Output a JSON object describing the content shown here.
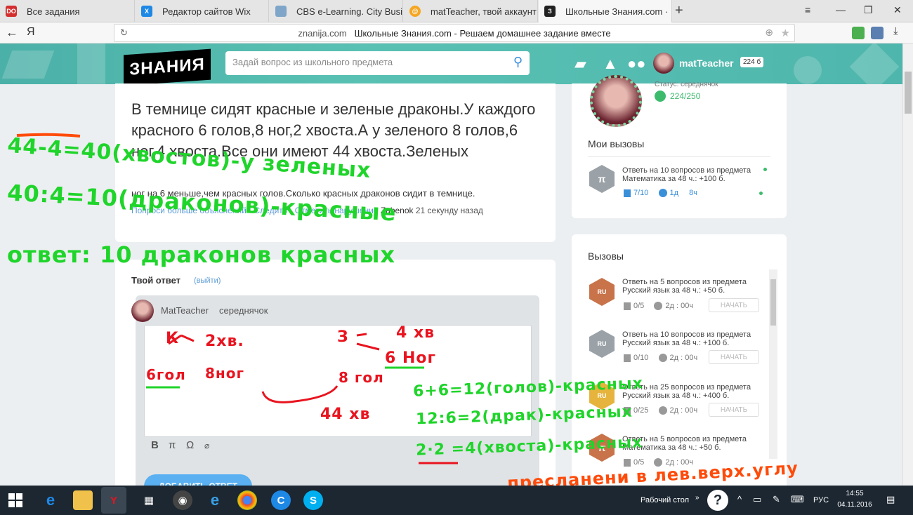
{
  "browser": {
    "tabs": [
      {
        "title": "Все задания",
        "icon": "dnevnik-icon",
        "color": "#d32f2f",
        "fav_text": "DO"
      },
      {
        "title": "Редактор сайтов Wix",
        "icon": "wix-icon",
        "color": "#1e88e5",
        "fav_text": "X"
      },
      {
        "title": "CBS e-Learning. City Busines",
        "icon": "cbs-icon",
        "color": "#7fa6c9",
        "fav_text": ""
      },
      {
        "title": "matTeacher, твой аккаунт го",
        "icon": "mail-icon",
        "color": "#f5a623",
        "fav_text": "@"
      },
      {
        "title": "Школьные Знания.com ·",
        "icon": "znanija-icon",
        "color": "#222222",
        "fav_text": "З"
      }
    ],
    "address_domain": "znanija.com",
    "address_title": "Школьные Знания.com - Решаем домашнее задание вместе",
    "yandex_label": "Я"
  },
  "header": {
    "logo_text": "ЗНАНИЯ",
    "search_placeholder": "Задай вопрос из школьного предмета",
    "username": "matTeacher",
    "points": "224 б"
  },
  "question": {
    "title": "В темнице сидят красные и зеленые драконы.У каждого красного 6 голов,8 ног,2 хвоста.А у зеленого 8 голов,6 ног,4 хвоста.Все они имеют 44 хвоста.Зеленых",
    "rest": "ног на 6 меньше,чем красных голов.Сколько красных драконов сидит в темнице.",
    "meta_links": "Попроси больше объяснений · Следить · Отметить нарушение",
    "author": "Zabenok",
    "time": "21 секунду назад"
  },
  "answer": {
    "heading": "Твой ответ",
    "exit_link": "(выйти)",
    "username": "MatTeacher",
    "rank": "середнячок",
    "toolbar": [
      "B",
      "π",
      "Ω",
      "⌀"
    ],
    "submit_label": "ДОБАВИТЬ ОТВЕТ"
  },
  "profile": {
    "status": "Статус: середнячок",
    "progress": "224/250"
  },
  "my_calls": {
    "title": "Мои вызовы",
    "item": {
      "text1": "Ответь на 10 вопросов из предмета",
      "text2": "Математика за 48 ч.: +100 б.",
      "progress": "7/10",
      "time1": "1д",
      "time2": "8ч"
    }
  },
  "calls": {
    "title": "Вызовы",
    "start_label": "НАЧАТЬ",
    "items": [
      {
        "text1": "Ответь на 5 вопросов из предмета",
        "text2": "Русский язык за 48 ч.: +50 б.",
        "progress": "0/5",
        "time": "2д : 00ч",
        "badge_color": "#c8734a",
        "badge_text": "RU"
      },
      {
        "text1": "Ответь на 10 вопросов из предмета",
        "text2": "Русский язык за 48 ч.: +100 б.",
        "progress": "0/10",
        "time": "2д : 00ч",
        "badge_color": "#9aa2a8",
        "badge_text": "RU"
      },
      {
        "text1": "Ответь на 25 вопросов из предмета",
        "text2": "Русский язык за 48 ч.: +400 б.",
        "progress": "0/25",
        "time": "2д : 00ч",
        "badge_color": "#e6b43c",
        "badge_text": "RU"
      },
      {
        "text1": "Ответь на 5 вопросов из предмета",
        "text2": "Математика за 48 ч.: +50 б.",
        "progress": "0/5",
        "time": "2д : 00ч",
        "badge_color": "#c8734a",
        "badge_text": "π"
      }
    ]
  },
  "handwriting": {
    "green1": "44-4=40(хвостов)-у зеленых",
    "green2": "40:4=10(драконов)-красные",
    "green3": "ответ: 10 драконов красных",
    "red_k": "К",
    "red_2xv": "2хв.",
    "red_6gol": "6гол",
    "red_8nog": "8ног",
    "red_z": "З",
    "red_4xv": "4 хв",
    "red_6nog": "6 Ног",
    "red_8gol": "8 гол",
    "red_44xv": "44 хв",
    "green4": "6+6=12(голов)-красных",
    "green5": "12:6=2(драк)-красных",
    "green6": "2·2 =4(хвоста)-красных",
    "orange1": "пресланени в лев.верх.углу"
  },
  "taskbar": {
    "desktop_label": "Рабочий стол",
    "lang": "РУС",
    "time": "14:55",
    "date": "04.11.2016"
  }
}
